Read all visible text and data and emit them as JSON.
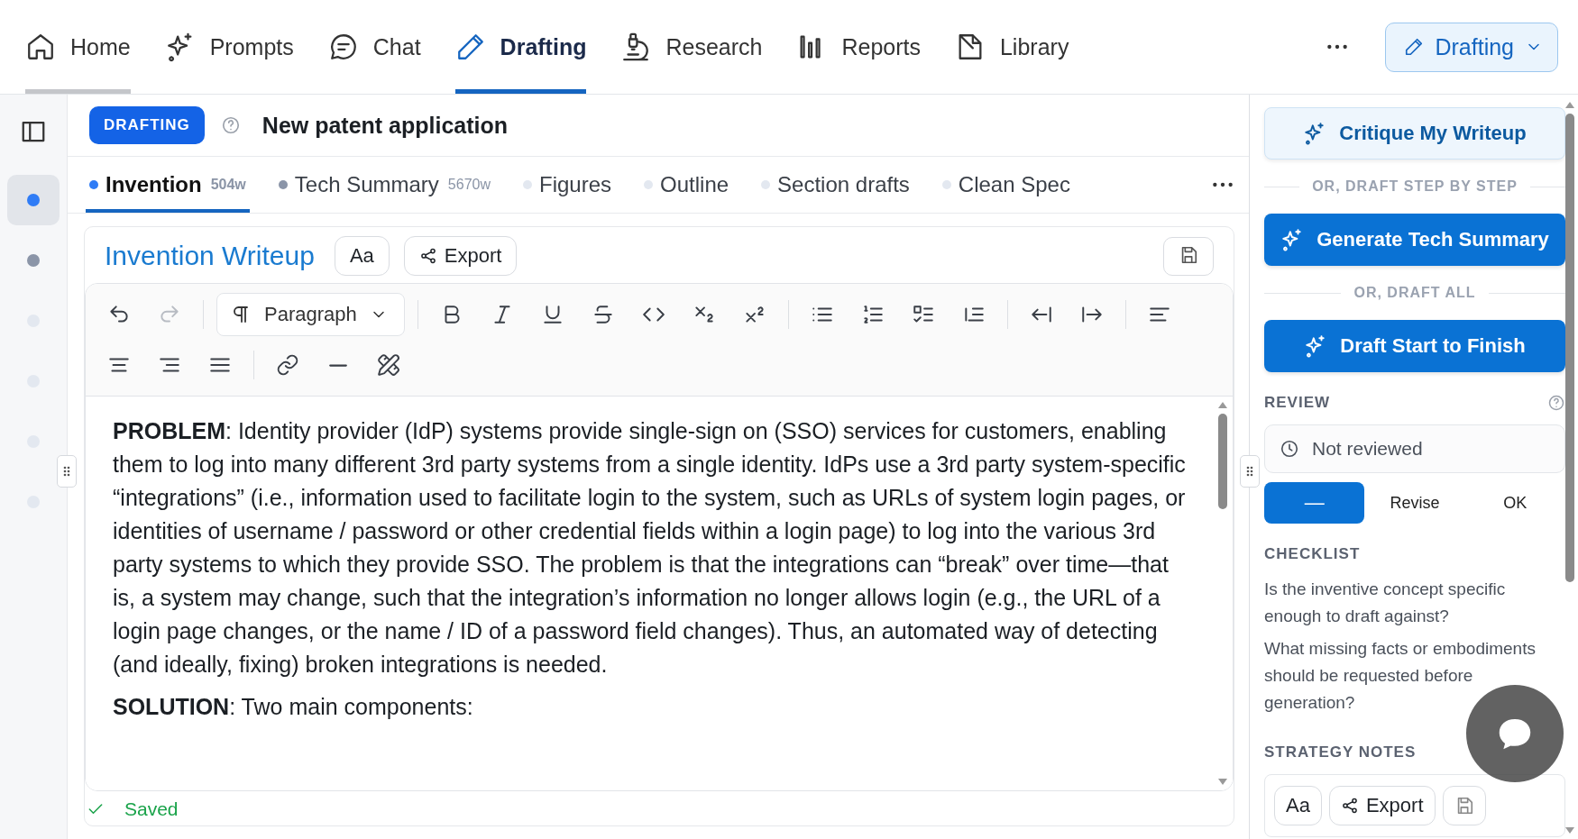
{
  "nav": {
    "items": [
      {
        "label": "Home",
        "selected": false,
        "hovered": true
      },
      {
        "label": "Prompts",
        "selected": false,
        "hovered": false
      },
      {
        "label": "Chat",
        "selected": false,
        "hovered": false
      },
      {
        "label": "Drafting",
        "selected": true,
        "hovered": false
      },
      {
        "label": "Research",
        "selected": false,
        "hovered": false
      },
      {
        "label": "Reports",
        "selected": false,
        "hovered": false
      },
      {
        "label": "Library",
        "selected": false,
        "hovered": false
      }
    ],
    "mode_button": "Drafting"
  },
  "rail": {
    "dots": [
      {
        "color": "#2f7cf6",
        "selected": true
      },
      {
        "color": "#8b95a8",
        "selected": false
      },
      {
        "color": "#e3e8f0",
        "selected": false
      },
      {
        "color": "#e3e8f0",
        "selected": false
      },
      {
        "color": "#e3e8f0",
        "selected": false
      },
      {
        "color": "#e3e8f0",
        "selected": false
      }
    ]
  },
  "header": {
    "badge": "DRAFTING",
    "title": "New patent application"
  },
  "tabs": [
    {
      "label": "Invention",
      "count": "504w",
      "color": "#2f7cf6",
      "selected": true
    },
    {
      "label": "Tech Summary",
      "count": "5670w",
      "color": "#8b95a8",
      "selected": false
    },
    {
      "label": "Figures",
      "color": "#e3e8f0",
      "selected": false
    },
    {
      "label": "Outline",
      "color": "#e3e8f0",
      "selected": false
    },
    {
      "label": "Section drafts",
      "color": "#e3e8f0",
      "selected": false
    },
    {
      "label": "Clean Spec",
      "color": "#e3e8f0",
      "selected": false
    }
  ],
  "editor": {
    "title": "Invention Writeup",
    "font_button": "Aa",
    "export_button": "Export",
    "toolbar": [
      [
        {
          "kind": "undo",
          "disabled": false
        },
        {
          "kind": "redo",
          "disabled": true
        },
        {
          "kind": "separator"
        },
        {
          "kind": "select",
          "label": "Paragraph"
        },
        {
          "kind": "separator"
        },
        {
          "kind": "bold"
        },
        {
          "kind": "italic"
        },
        {
          "kind": "underline"
        },
        {
          "kind": "strike"
        },
        {
          "kind": "code"
        },
        {
          "kind": "subscript"
        },
        {
          "kind": "superscript"
        },
        {
          "kind": "separator"
        },
        {
          "kind": "bullets"
        },
        {
          "kind": "numbers"
        },
        {
          "kind": "tasks"
        },
        {
          "kind": "nested"
        },
        {
          "kind": "separator"
        },
        {
          "kind": "outdent"
        },
        {
          "kind": "indent"
        },
        {
          "kind": "separator"
        },
        {
          "kind": "left"
        }
      ],
      [
        {
          "kind": "center"
        },
        {
          "kind": "right"
        },
        {
          "kind": "justify"
        },
        {
          "kind": "separator"
        },
        {
          "kind": "link"
        },
        {
          "kind": "rule"
        },
        {
          "kind": "clear"
        }
      ]
    ],
    "paragraphs": [
      "**PROBLEM**: Identity provider (IdP) systems provide single-sign on (SSO) services for customers, enabling them to log into many different 3rd party systems from a single identity.  IdPs use a 3rd party system-specific “integrations” (i.e., information used to facilitate login to the system, such as URLs of system login pages, or identities of username / password or other credential fields within a login page) to log into the various 3rd party systems to which they provide SSO.  The problem is that the integrations can “break” over time—that is, a system may change, such that the integration’s information no longer allows login (e.g., the URL of a login page changes, or the name / ID of a password field changes).  Thus, an automated way of detecting (and ideally, fixing) broken integrations is needed.",
      "**SOLUTION**: Two main components:"
    ],
    "status": "Saved"
  },
  "side": {
    "actions": [
      {
        "kind": "secondary",
        "label": "Critique My Writeup"
      },
      {
        "kind": "divider",
        "label": "OR, DRAFT STEP BY STEP"
      },
      {
        "kind": "primary",
        "label": "Generate Tech Summary"
      },
      {
        "kind": "divider",
        "label": "OR, DRAFT ALL"
      },
      {
        "kind": "primary",
        "label": "Draft Start to Finish"
      }
    ],
    "review": {
      "heading": "REVIEW",
      "status": "Not reviewed",
      "options": [
        {
          "label": "—",
          "selected": true
        },
        {
          "label": "Revise",
          "selected": false
        },
        {
          "label": "OK",
          "selected": false
        }
      ]
    },
    "checklist": {
      "heading": "CHECKLIST",
      "items": [
        "Is the inventive concept specific enough to draft against?",
        "What missing facts or embodiments should be requested before generation?"
      ]
    },
    "strategy": {
      "heading": "STRATEGY NOTES",
      "font_button": "Aa",
      "export_button": "Export"
    }
  }
}
